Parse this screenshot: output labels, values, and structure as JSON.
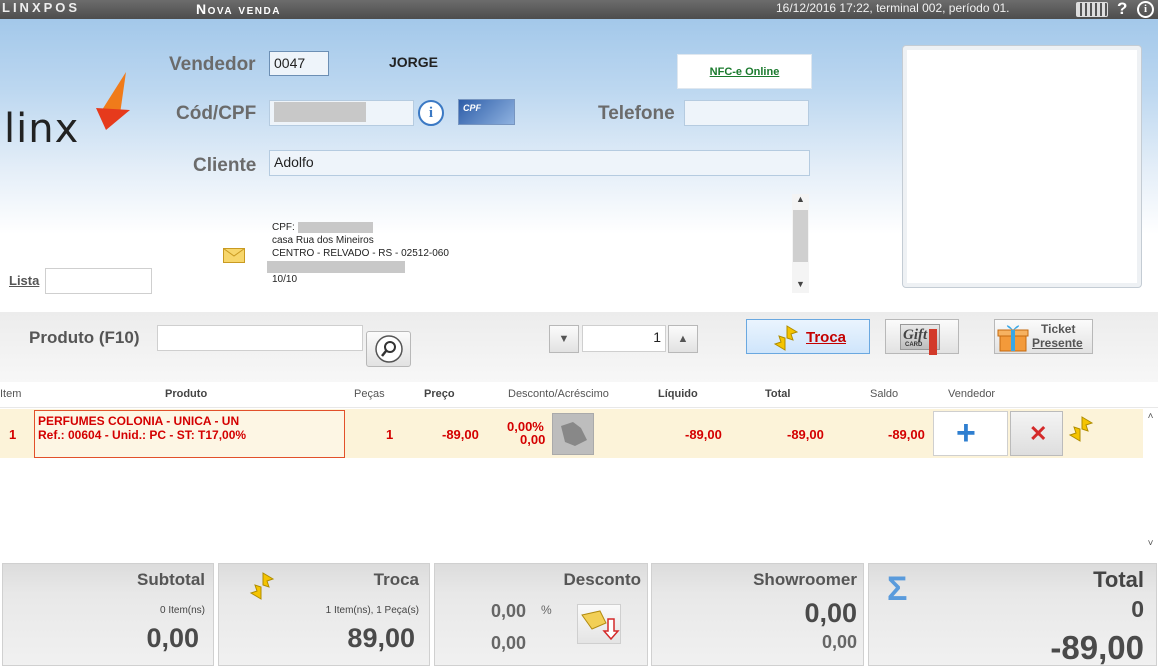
{
  "titlebar": {
    "brand": "LINXPOS",
    "screen_title": "Nova venda",
    "status": "16/12/2016 17:22, terminal 002, período 01.",
    "help": "?",
    "info": "i"
  },
  "header": {
    "logo_text": "linx",
    "vendedor_label": "Vendedor",
    "vendedor_code": "0047",
    "vendedor_name": "JORGE",
    "cpf_label": "Cód/CPF",
    "cpf_badge": "CPF",
    "telefone_label": "Telefone",
    "telefone_value": "",
    "cliente_label": "Cliente",
    "cliente_value": "Adolfo",
    "nfce_link": "NFC-e Online",
    "lista_label": "Lista",
    "lista_value": "",
    "address": {
      "cpf_line": "CPF:",
      "street": "casa Rua dos Mineiros",
      "city": "CENTRO - RELVADO - RS - 02512-060",
      "extra": "10/10"
    }
  },
  "product_bar": {
    "label": "Produto (F10)",
    "search_value": "",
    "quantity": "1",
    "troca_button": "Troca",
    "gift_label": "Gift",
    "gift_sub": "CARD",
    "ticket_line1": "Ticket",
    "ticket_line2": "Presente"
  },
  "grid": {
    "columns": [
      "Item",
      "Produto",
      "Peças",
      "Preço",
      "Desconto/Acréscimo",
      "Líquido",
      "Total",
      "Saldo",
      "Vendedor"
    ],
    "rows": [
      {
        "item": "1",
        "produto_line1": "PERFUMES COLONIA - UNICA - UN",
        "produto_line2": "Ref.: 00604 - Unid.: PC - ST: T17,00%",
        "pecas": "1",
        "preco": "-89,00",
        "desconto_pct": "0,00%",
        "desconto_val": "0,00",
        "liquido": "-89,00",
        "total": "-89,00",
        "saldo": "-89,00"
      }
    ]
  },
  "totals": {
    "subtotal": {
      "title": "Subtotal",
      "items": "0 Item(ns)",
      "value": "0,00"
    },
    "troca": {
      "title": "Troca",
      "items": "1 Item(ns), 1 Peça(s)",
      "value": "89,00"
    },
    "desconto": {
      "title": "Desconto",
      "pct": "0,00",
      "pct_sign": "%",
      "value": "0,00"
    },
    "showroomer": {
      "title": "Showroomer",
      "value1": "0,00",
      "value2": "0,00"
    },
    "total": {
      "title": "Total",
      "sigma": "Σ",
      "count": "0",
      "value": "-89,00"
    }
  },
  "colors": {
    "accent_red": "#d40000",
    "header_blue": "#a3c8ea",
    "row_highlight": "#fcf3d9",
    "link_green": "#1a7a2d"
  }
}
